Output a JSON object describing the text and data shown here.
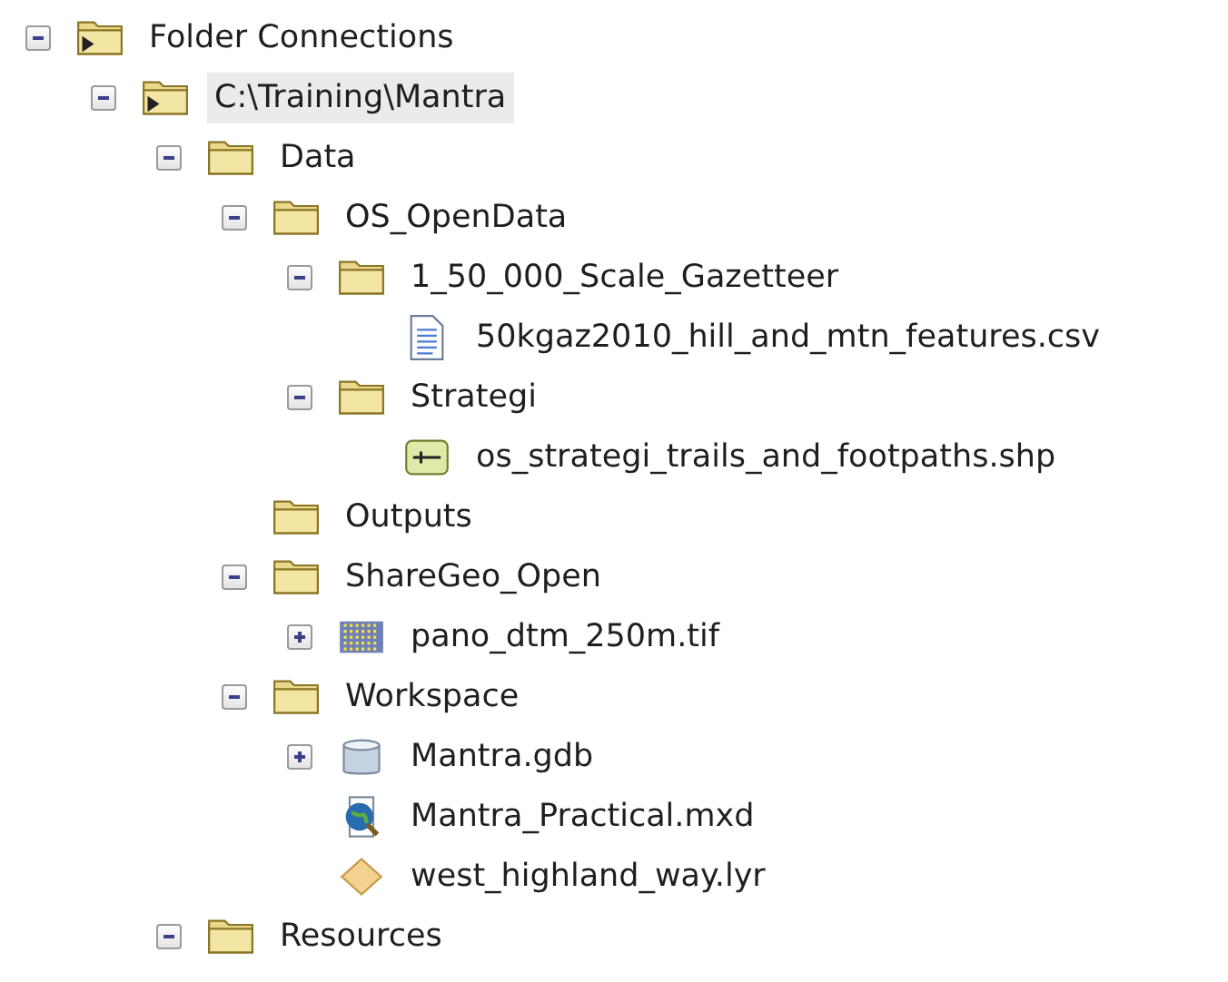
{
  "tree": [
    {
      "label": "Folder Connections",
      "kind": "folder-connection",
      "expanded": true,
      "selected": false,
      "children": [
        {
          "label": "C:\\Training\\Mantra",
          "kind": "folder-connection",
          "expanded": true,
          "selected": true,
          "children": [
            {
              "label": "Data",
              "kind": "folder",
              "expanded": true,
              "selected": false,
              "children": [
                {
                  "label": "OS_OpenData",
                  "kind": "folder",
                  "expanded": true,
                  "selected": false,
                  "children": [
                    {
                      "label": "1_50_000_Scale_Gazetteer",
                      "kind": "folder",
                      "expanded": true,
                      "selected": false,
                      "children": [
                        {
                          "label": "50kgaz2010_hill_and_mtn_features.csv",
                          "kind": "csv",
                          "selected": false
                        }
                      ]
                    },
                    {
                      "label": "Strategi",
                      "kind": "folder",
                      "expanded": true,
                      "selected": false,
                      "children": [
                        {
                          "label": "os_strategi_trails_and_footpaths.shp",
                          "kind": "shapefile",
                          "selected": false
                        }
                      ]
                    }
                  ]
                },
                {
                  "label": "Outputs",
                  "kind": "folder",
                  "selected": false
                },
                {
                  "label": "ShareGeo_Open",
                  "kind": "folder",
                  "expanded": true,
                  "selected": false,
                  "children": [
                    {
                      "label": "pano_dtm_250m.tif",
                      "kind": "raster",
                      "expanded": false,
                      "selected": false
                    }
                  ]
                },
                {
                  "label": "Workspace",
                  "kind": "folder",
                  "expanded": true,
                  "selected": false,
                  "children": [
                    {
                      "label": "Mantra.gdb",
                      "kind": "geodatabase",
                      "expanded": false,
                      "selected": false
                    },
                    {
                      "label": "Mantra_Practical.mxd",
                      "kind": "map-document",
                      "selected": false
                    },
                    {
                      "label": "west_highland_way.lyr",
                      "kind": "layer-file",
                      "selected": false
                    }
                  ]
                }
              ]
            },
            {
              "label": "Resources",
              "kind": "folder",
              "expanded": true,
              "selected": false
            }
          ]
        }
      ]
    }
  ]
}
